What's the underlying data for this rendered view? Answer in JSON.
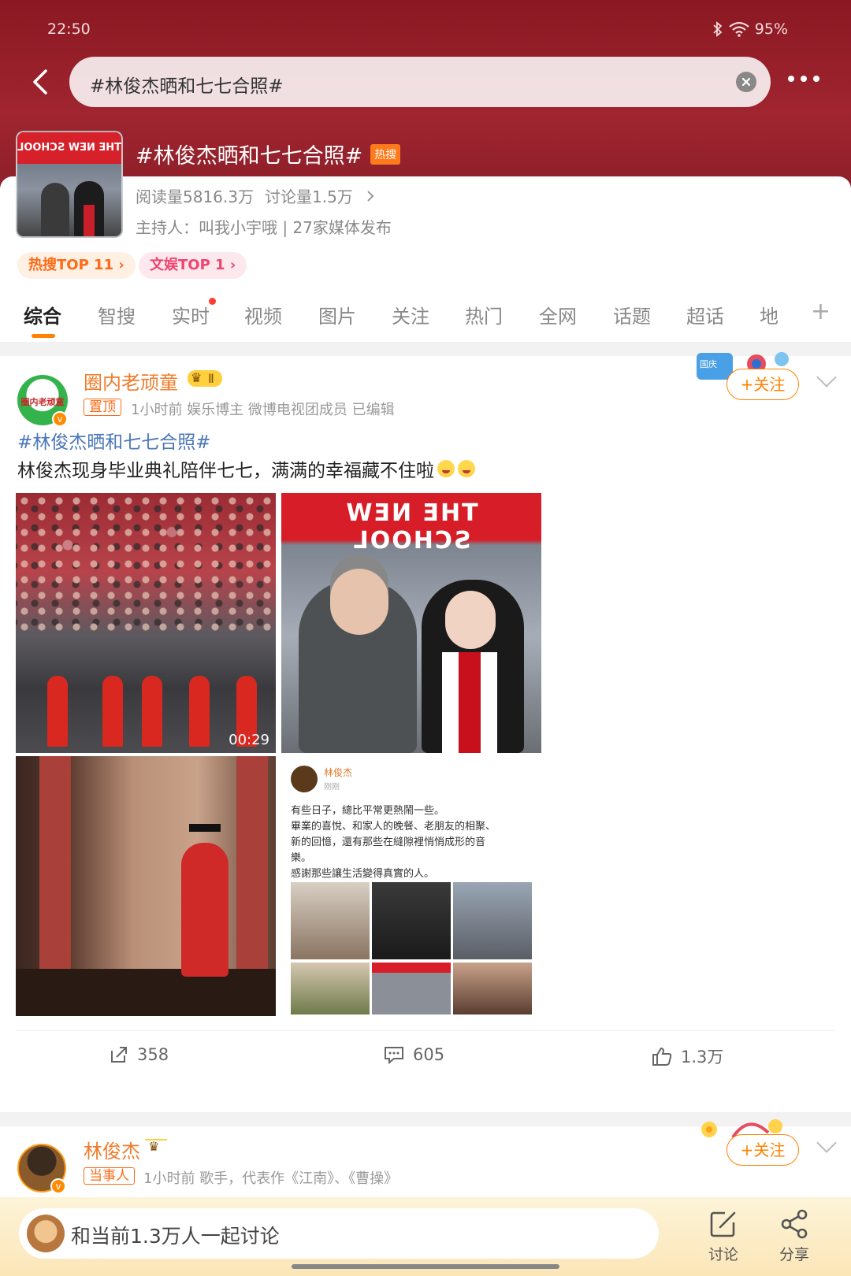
{
  "status_bar": {
    "time": "22:50",
    "battery": "95%"
  },
  "search": {
    "query": "#林俊杰晒和七七合照#"
  },
  "topic": {
    "title": "#林俊杰晒和七七合照#",
    "badge": "热搜",
    "reads": "阅读量5816.3万",
    "discussions": "讨论量1.5万",
    "host": "主持人：叫我小宇哦 | 27家媒体发布",
    "rank_hot": "热搜TOP 11",
    "rank_ent": "文娱TOP 1"
  },
  "tabs": [
    {
      "label": "综合"
    },
    {
      "label": "智搜"
    },
    {
      "label": "实时"
    },
    {
      "label": "视频"
    },
    {
      "label": "图片"
    },
    {
      "label": "关注"
    },
    {
      "label": "热门"
    },
    {
      "label": "全网"
    },
    {
      "label": "话题"
    },
    {
      "label": "超话"
    },
    {
      "label": "地"
    }
  ],
  "post1": {
    "author": "圈内老顽童",
    "avatar_text": "圈内老顽童",
    "level": "Ⅱ",
    "pinned": "置顶",
    "meta": "1小时前  娱乐博主 微博电视团成员  已编辑",
    "hashtag": "#林俊杰晒和七七合照#",
    "text": "林俊杰现身毕业典礼陪伴七七，满满的幸福藏不住啦",
    "video_duration": "00:29",
    "image1_sign": "THE NEW SCHOOL",
    "follow": "+关注",
    "embedded": {
      "name": "林俊杰",
      "time": "刚刚",
      "text": "有些日子，總比平常更熱鬧一些。\n畢業的喜悅、和家人的晚餐、老朋友的相聚、\n新的回憶，還有那些在縫隙裡悄悄成形的音\n樂。\n感謝那些讓生活變得真實的人。"
    },
    "reposts": "358",
    "comments": "605",
    "likes": "1.3万"
  },
  "post2": {
    "author": "林俊杰",
    "role": "当事人",
    "meta": "1小时前  歌手，代表作《江南》、《曹操》",
    "follow": "+关注"
  },
  "bottom_bar": {
    "placeholder": "和当前1.3万人一起讨论",
    "discuss": "讨论",
    "share": "分享"
  },
  "colors": {
    "accent": "#ff8200",
    "header": "#9a2230",
    "link": "#4a76b8"
  }
}
